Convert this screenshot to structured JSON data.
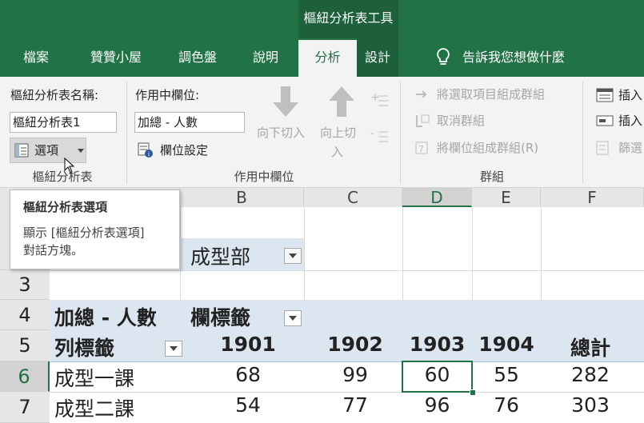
{
  "context_tab_header": "樞紐分析表工具",
  "tabs": [
    "檔案",
    "贊贊小屋",
    "調色盤",
    "說明",
    "分析",
    "設計"
  ],
  "tell_me": "告訴我您想做什麼",
  "ribbon": {
    "pivot_group": {
      "name_label": "樞紐分析表名稱:",
      "name_value": "樞紐分析表1",
      "options_label": "選項",
      "group_label": "樞紐分析表"
    },
    "active_field_group": {
      "label": "作用中欄位:",
      "value": "加總 - 人數",
      "field_settings": "欄位設定",
      "drill_down": "向下切入",
      "drill_up_line1": "向上切",
      "drill_up_line2": "入",
      "group_label": "作用中欄位"
    },
    "group_group": {
      "group_selection": "將選取項目組成群組",
      "ungroup": "取消群組",
      "group_field": "將欄位組成群組(R)",
      "group_label": "群組"
    },
    "insert_group": {
      "insert_slicer": "插入",
      "insert_timeline": "插入",
      "filter_connections": "篩選"
    }
  },
  "tooltip": {
    "title": "樞紐分析表選項",
    "line1": "顯示 [樞紐分析表選項]",
    "line2": "對話方塊。"
  },
  "sheet": {
    "columns": [
      "B",
      "C",
      "D",
      "E",
      "F"
    ],
    "rows": [
      "3",
      "4",
      "5",
      "6",
      "7"
    ],
    "filter_value": "成型部",
    "values_caption": "加總 - 人數",
    "column_labels_caption": "欄標籤",
    "row_labels_caption": "列標籤",
    "year_headers": [
      "1901",
      "1902",
      "1903",
      "1904",
      "總計"
    ],
    "data_rows": [
      {
        "label": "成型一課",
        "values": [
          "68",
          "99",
          "60",
          "55",
          "282"
        ]
      },
      {
        "label": "成型二課",
        "values": [
          "54",
          "77",
          "96",
          "76",
          "303"
        ]
      }
    ]
  },
  "colors": {
    "ribbon_green": "#217346",
    "context_green": "#1e5f3c",
    "pivot_header_fill": "#dce6f1"
  }
}
